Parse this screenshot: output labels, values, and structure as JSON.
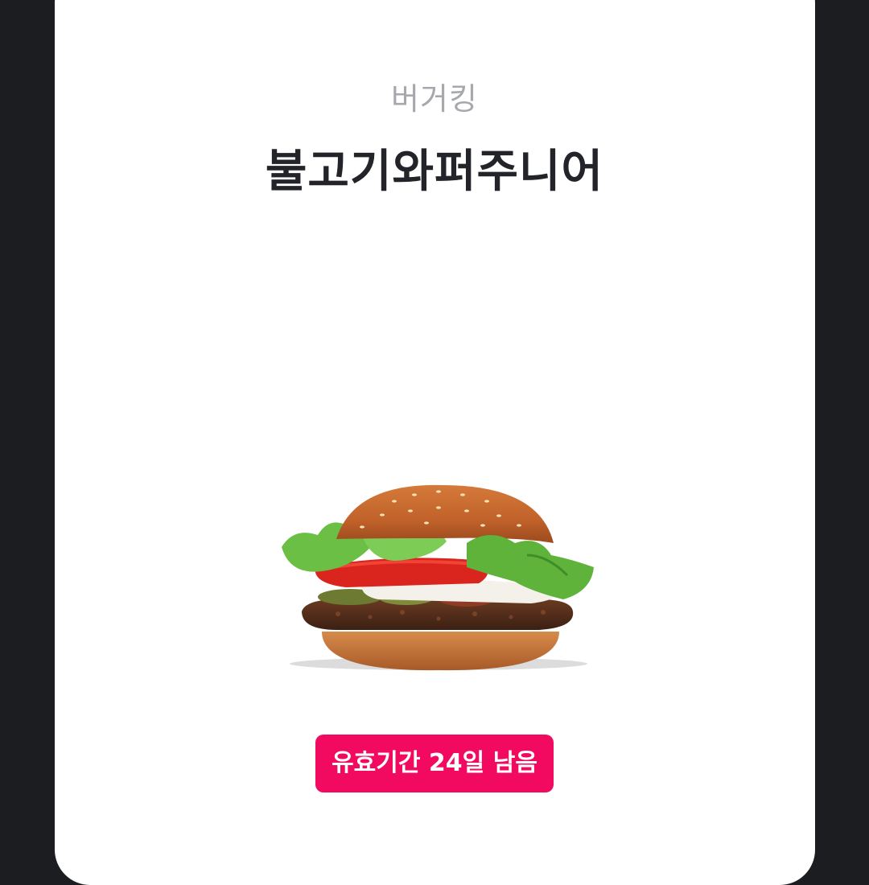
{
  "coupon": {
    "brand": "버거킹",
    "product_name": "불고기와퍼주니어",
    "expiry_badge": "유효기간 24일 남음",
    "image_subject": "burger-image"
  },
  "colors": {
    "background": "#1b1d21",
    "card": "#ffffff",
    "badge": "#f20a60",
    "brand_text": "#a6a8ad",
    "title_text": "#222429"
  }
}
